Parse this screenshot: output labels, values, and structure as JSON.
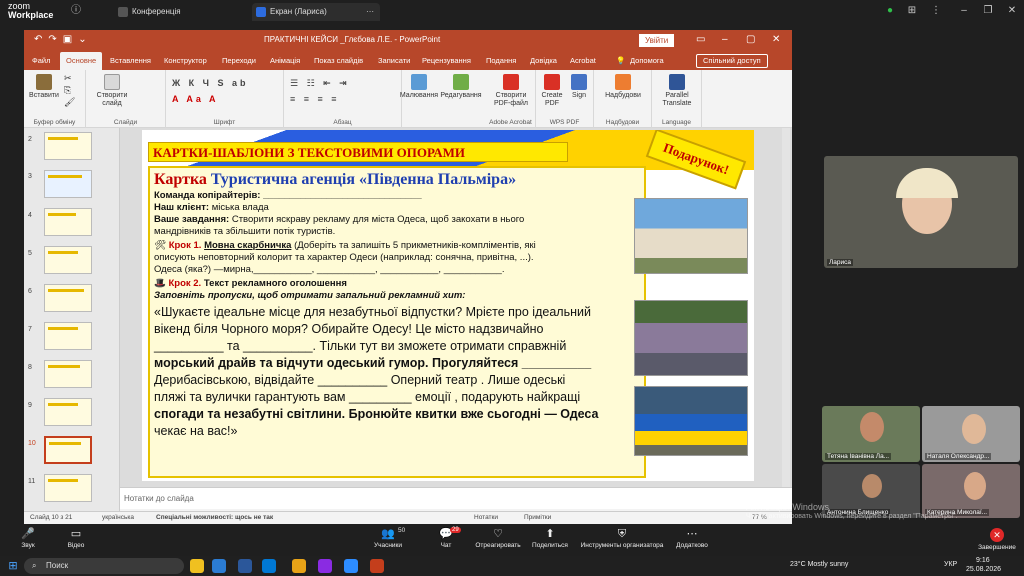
{
  "zoom": {
    "brand_line1": "zoom",
    "brand_line2": "Workplace",
    "tab_conference": "Конференція",
    "tab_screen": "Екран (Лариса)"
  },
  "ppt": {
    "title": "ПРАКТИЧНІ КЕЙСИ _Глєбова Л.Е.  -  PowerPoint",
    "signin": "Увійти",
    "tabs": [
      "Файл",
      "Основне",
      "Вставлення",
      "Конструктор",
      "Переходи",
      "Анімація",
      "Показ слайдів",
      "Записати",
      "Рецензування",
      "Подання",
      "Довідка",
      "Acrobat",
      "Допомога"
    ],
    "share": "Спільний доступ",
    "ribbon": {
      "paste": "Вставити",
      "new_slide": "Створити слайд",
      "dictate": "Малювання",
      "editing": "Редагування",
      "create_pdf": "Створити PDF-файл",
      "create_pdf2": "Create PDF",
      "sign": "Sign",
      "addins": "Надбудови",
      "parallel": "Parallel Translate",
      "g_clipboard": "Буфер обміну",
      "g_slides": "Слайди",
      "g_font": "Шрифт",
      "g_paragraph": "Абзац",
      "g_acrobat": "Adobe Acrobat",
      "g_wps": "WPS PDF",
      "g_addins": "Надбудови",
      "g_language": "Language"
    },
    "thumb_numbers": [
      "2",
      "3",
      "4",
      "5",
      "6",
      "7",
      "8",
      "9",
      "10",
      "11"
    ],
    "notes_placeholder": "Нотатки до слайда",
    "status": {
      "slide": "Слайд 10 з 21",
      "lang": "українська",
      "access": "Спеціальні можливості: щось не так",
      "notes": "Нотатки",
      "comments": "Примітки",
      "zoom": "77 %"
    }
  },
  "slide": {
    "header": "КАРТКИ-ШАБЛОНИ З ТЕКСТОВИМИ ОПОРАМИ",
    "badge": "Подарунок!",
    "card_word": "Картка",
    "card_title": "Туристична агенція «Південна Пальміра»",
    "team_label": "Команда копірайтерів:",
    "client_label": "Наш клієнт:",
    "client_value": "міська влада",
    "task_label": "Ваше завдання:",
    "task_line1": "Створити яскраву рекламу для міста Одеса, щоб закохати в нього",
    "task_line2": "мандрівників та збільшити потік туристів.",
    "step1_label": "Крок 1.",
    "step1_title": "Мовна скарбничка",
    "step1_line1": "(Доберіть та запишіть 5 прикметників-компліментів, які",
    "step1_line2": "описують неповторний колорит та характер Одеси (наприклад: сонячна, привітна, ...).",
    "step1_line3": "Одеса  (яка?) —мирна,___________, ___________, ___________, ___________.",
    "step2_label": "Крок 2.",
    "step2_title": "Текст рекламного оголошення",
    "step2_hint": "Заповніть пропуски, щоб отримати запальний рекламний хит:",
    "ad_lines": [
      "«Шукаєте ідеальне місце для незабутньої відпустки? Мрієте про ідеальний",
      "вікенд біля Чорного моря? Обирайте Одесу! Це місто надзвичайно",
      "__________ та __________. Тільки тут ви зможете отримати справжній",
      "морський драйв та відчути одеський гумор. Прогуляйтеся __________",
      "Дерибасівською, відвідайте __________ Оперний театр . Лише одеські",
      "пляжі та вулички гарантують вам _________ емоції , подарують найкращі",
      "спогади  та незабутні світлини. Бронюйте квитки вже сьогодні — Одеса",
      "чекає на вас!»"
    ]
  },
  "gallery": {
    "presenter": "Лариса",
    "p2": "Тетяна Іванівна Ла...",
    "p3": "Наталя Олександр...",
    "p4": "Антонина Блищенко",
    "p5": "Катерина Миколаї..."
  },
  "toolbar": {
    "mic": "Звук",
    "video": "Відео",
    "participants": "Учасники",
    "participants_count": "50",
    "chat": "Чат",
    "chat_badge": "29",
    "react": "Отреагировать",
    "share": "Поделиться",
    "host_tools": "Инструменты организатора",
    "more": "Додатково",
    "end": "Завершение"
  },
  "win_activate": {
    "line1": "Активация Windows",
    "line2": "Чтобы активировать Windows, перейдите в раздел \"Параметры\"."
  },
  "taskbar": {
    "search": "Поиск",
    "weather": "23°C  Mostly sunny",
    "lang": "УКР",
    "time": "9:16",
    "date": "25.08.2026"
  },
  "colors": {
    "ppt_accent": "#b7472a",
    "card_bg": "#fffbd6",
    "header_yellow": "#ffe800",
    "title_red": "#c00000",
    "title_blue": "#1f3fb0",
    "end_red": "#e02828"
  }
}
